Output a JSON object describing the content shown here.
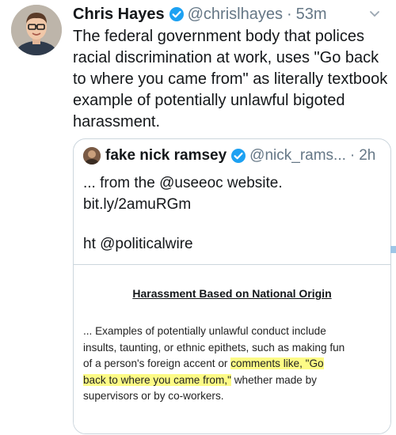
{
  "tweet": {
    "author_name": "Chris Hayes",
    "handle": "@chrislhayes",
    "separator": "·",
    "time": "53m",
    "text_lines": [
      "The federal government body that polices",
      "racial discrimination at work, uses \"Go back",
      "to where you came from\" as literally textbook",
      "example of potentially unlawful bigoted",
      "harassment."
    ]
  },
  "quoted_tweet": {
    "author_name": "fake nick ramsey",
    "handle": "@nick_rams...",
    "separator": "·",
    "time": "2h",
    "text_lines": [
      "... from the @useeoc website.",
      "bit.ly/2amuRGm",
      "ht @politicalwire"
    ],
    "embed": {
      "title": "Harassment Based on National Origin",
      "lines": [
        "... Examples of potentially unlawful conduct include",
        "insults, taunting, or ethnic epithets, such as making fun",
        "of a person's foreign accent or ",
        "comments like, \"Go",
        "back to where you came from,\"",
        " whether made by",
        "supervisors or by co-workers."
      ]
    }
  },
  "colors": {
    "verified_blue": "#1da1f2",
    "secondary_text": "#657786",
    "highlight": "#fdfb86",
    "border": "#ccd6dd"
  },
  "icons": [
    "verified-badge-icon",
    "chevron-down-icon"
  ]
}
